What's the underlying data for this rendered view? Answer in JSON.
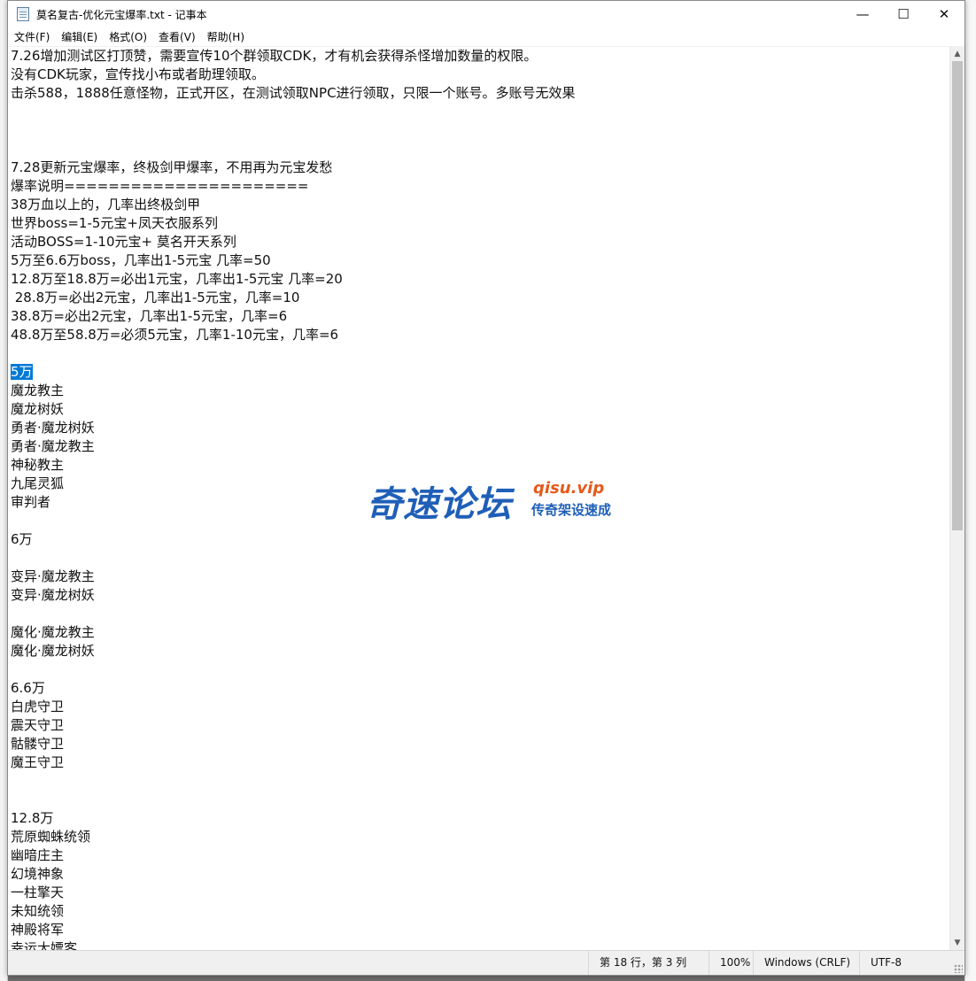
{
  "window": {
    "title": "莫名复古-优化元宝爆率.txt - 记事本",
    "minimize": "—",
    "maximize": "☐",
    "close": "✕"
  },
  "menu": [
    {
      "label": "文件(F)"
    },
    {
      "label": "编辑(E)"
    },
    {
      "label": "格式(O)"
    },
    {
      "label": "查看(V)"
    },
    {
      "label": "帮助(H)"
    }
  ],
  "editor": {
    "lines": [
      "7.26增加测试区打顶赞，需要宣传10个群领取CDK，才有机会获得杀怪增加数量的权限。",
      "没有CDK玩家，宣传找小布或者助理领取。",
      "击杀588，1888任意怪物，正式开区，在测试领取NPC进行领取，只限一个账号。多账号无效果",
      "",
      "",
      "",
      "7.28更新元宝爆率，终极剑甲爆率，不用再为元宝发愁",
      "爆率说明======================",
      "38万血以上的，几率出终极剑甲",
      "世界boss=1-5元宝+凤天衣服系列",
      "活动BOSS=1-10元宝+ 莫名开天系列",
      "5万至6.6万boss，几率出1-5元宝 几率=50",
      "12.8万至18.8万=必出1元宝，几率出1-5元宝 几率=20",
      " 28.8万=必出2元宝，几率出1-5元宝，几率=10",
      "38.8万=必出2元宝，几率出1-5元宝，几率=6",
      "48.8万至58.8万=必须5元宝，几率1-10元宝，几率=6",
      "",
      "5万",
      "魔龙教主",
      "魔龙树妖",
      "勇者·魔龙树妖",
      "勇者·魔龙教主",
      "神秘教主",
      "九尾灵狐",
      "审判者",
      "",
      "6万",
      "",
      "变异·魔龙教主",
      "变异·魔龙树妖",
      "",
      "魔化·魔龙教主",
      "魔化·魔龙树妖",
      "",
      "6.6万",
      "白虎守卫",
      "震天守卫",
      "骷髅守卫",
      "魔王守卫",
      "",
      "",
      "12.8万",
      "荒原蜘蛛统领",
      "幽暗庄主",
      "幻境神象",
      "一柱擎天",
      "未知统领",
      "神殿将军",
      "幸运大嫖客"
    ]
  },
  "status": {
    "position": "第 18 行，第 3 列",
    "zoom": "100%",
    "line_ending": "Windows (CRLF)",
    "encoding": "UTF-8"
  },
  "watermark": {
    "main": "奇速论坛",
    "url": "qisu.vip",
    "sub": "传奇架设速成"
  },
  "icons": {
    "app": "notepad-icon",
    "scroll_up": "chevron-up-icon",
    "scroll_down": "chevron-down-icon"
  }
}
